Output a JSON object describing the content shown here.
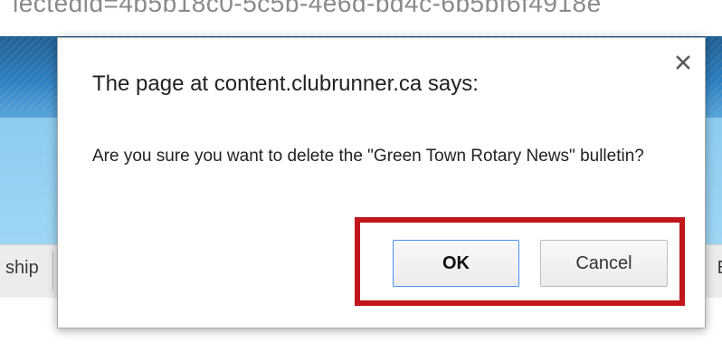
{
  "background": {
    "url_fragment": "lectedid=4b5b18c0-5c5b-4e6d-bd4c-6b5bf6f4918e",
    "nav_left_text": "ship",
    "nav_right_text": "E"
  },
  "dialog": {
    "title": "The page at content.clubrunner.ca says:",
    "message": "Are you sure you want to delete the \"Green Town Rotary News\" bulletin?",
    "ok_label": "OK",
    "cancel_label": "Cancel",
    "close_icon": "close-icon"
  },
  "colors": {
    "highlight": "#c0161c",
    "ok_border": "#4d90fe",
    "header_blue": "#2e7fc0",
    "light_blue": "#9fd6f4"
  }
}
